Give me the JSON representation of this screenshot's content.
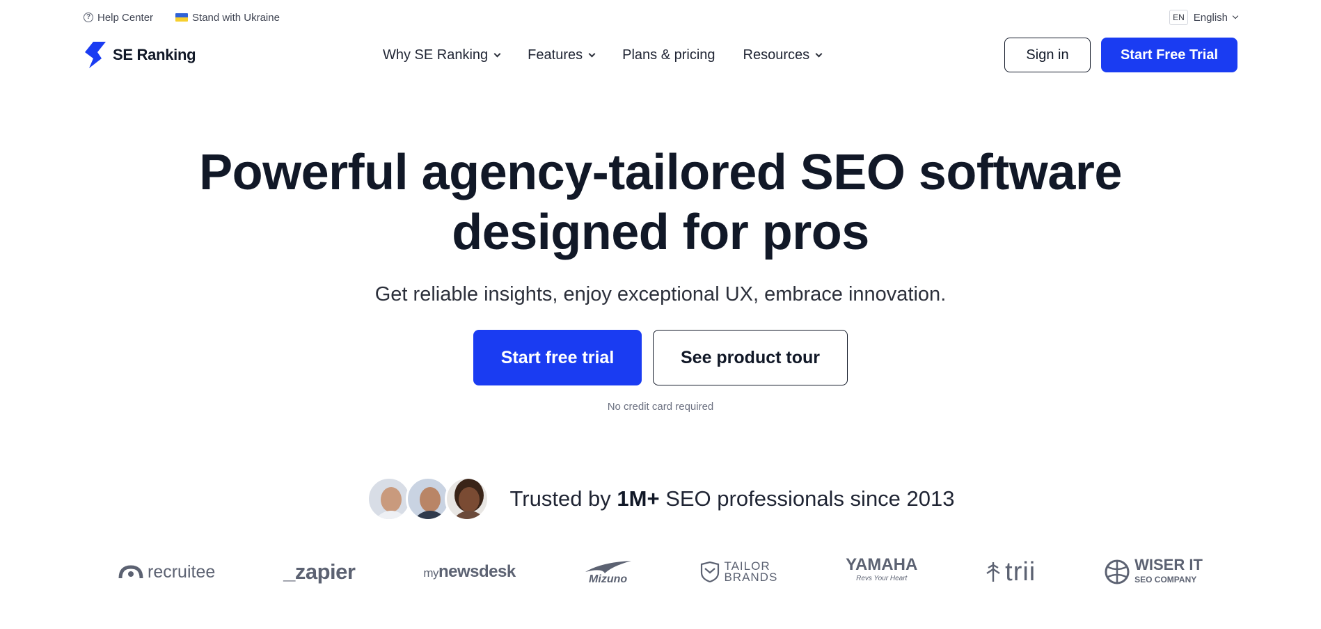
{
  "topbar": {
    "help_label": "Help Center",
    "ukraine_label": "Stand with Ukraine",
    "lang_code": "EN",
    "lang_label": "English"
  },
  "nav": {
    "logo_text": "SE Ranking",
    "menu": [
      {
        "label": "Why SE Ranking",
        "has_dropdown": true
      },
      {
        "label": "Features",
        "has_dropdown": true
      },
      {
        "label": "Plans & pricing",
        "has_dropdown": false
      },
      {
        "label": "Resources",
        "has_dropdown": true
      }
    ],
    "signin_label": "Sign in",
    "trial_label": "Start Free Trial"
  },
  "hero": {
    "title_line1": "Powerful agency-tailored SEO software",
    "title_line2": "designed for pros",
    "subtitle": "Get reliable insights, enjoy exceptional UX, embrace innovation.",
    "primary_cta": "Start free trial",
    "secondary_cta": "See product tour",
    "note": "No credit card required"
  },
  "trusted": {
    "prefix": "Trusted by ",
    "highlight": "1M+",
    "suffix": " SEO professionals since 2013"
  },
  "logos": {
    "recruitee": "recruitee",
    "zapier": "_zapier",
    "newsdesk_my": "my",
    "newsdesk_main": "newsdesk",
    "mizuno": "Mizuno",
    "tailor_line1": "TAILOR",
    "tailor_line2": "BRANDS",
    "yamaha": "YAMAHA",
    "yamaha_tagline": "Revs Your Heart",
    "trii": "trii",
    "wiser_line1": "WISER IT",
    "wiser_line2": "SEO COMPANY"
  },
  "colors": {
    "brand_blue": "#1a3cf2",
    "text_dark": "#111827",
    "logo_gray": "#5c6272"
  }
}
